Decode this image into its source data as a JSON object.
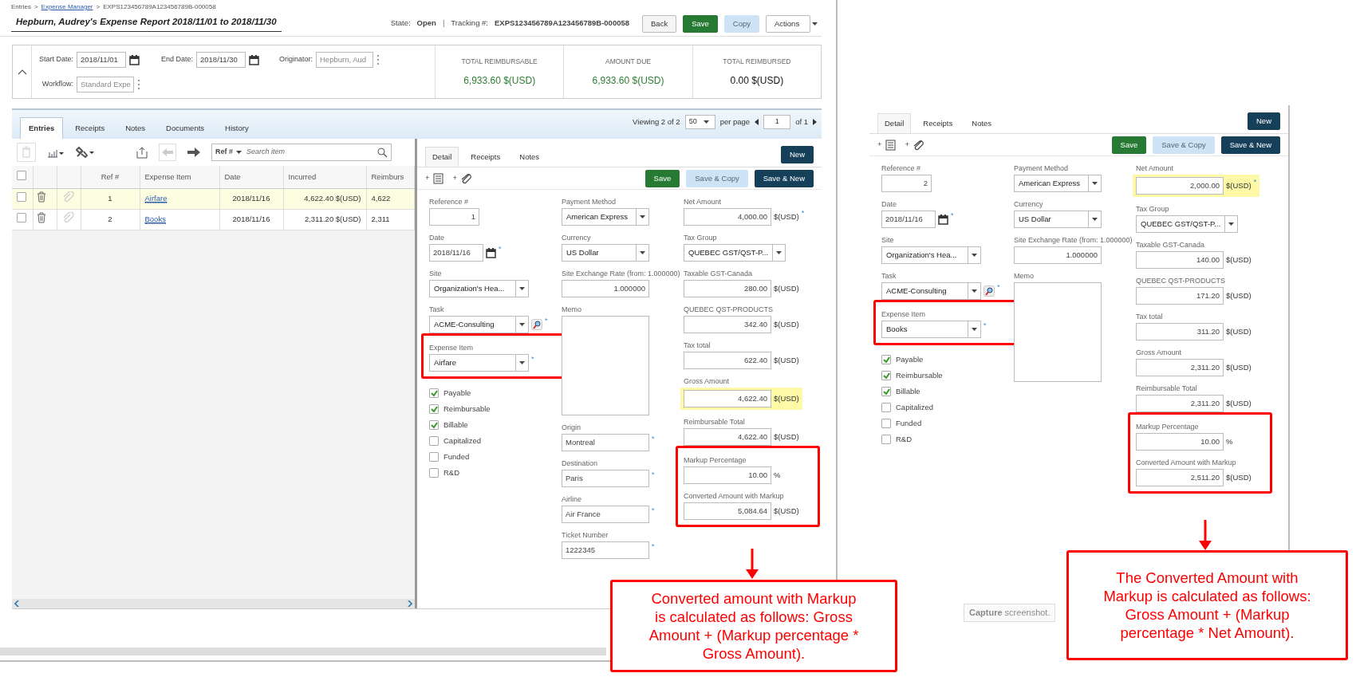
{
  "breadcrumb": {
    "separator": ">",
    "items": [
      {
        "text": "Entries",
        "link": false
      },
      {
        "text": "Expense Manager",
        "link": true
      },
      {
        "text": "EXPS123456789A123456789B-000058",
        "link": false
      }
    ]
  },
  "report": {
    "title": "Hepburn, Audrey's Expense Report 2018/11/01 to 2018/11/30",
    "state_label": "State:",
    "state": "Open",
    "divider": "|",
    "tracking_label": "Tracking #:",
    "tracking": "EXPS123456789A123456789B-000058",
    "buttons": [
      {
        "label": "Back",
        "kind": "default"
      },
      {
        "label": "Save",
        "kind": "success"
      },
      {
        "label": "Copy",
        "kind": "light"
      },
      {
        "label": "Actions",
        "kind": "dropdown"
      }
    ]
  },
  "summary": {
    "expanded": true,
    "fields": [
      {
        "label": "Start Date:",
        "value": "2018/11/01",
        "kind": "date"
      },
      {
        "label": "End Date:",
        "value": "2018/11/30",
        "kind": "date"
      },
      {
        "label": "Originator:",
        "value": "Hepburn, Aud",
        "kind": "picker",
        "disabled": true
      },
      {
        "label": "Workflow:",
        "value": "Standard Expe",
        "kind": "picker",
        "disabled": true
      }
    ],
    "totals": [
      {
        "label": "TOTAL REIMBURSABLE",
        "value": "6,933.60 $(USD)",
        "color": "#2e7d32"
      },
      {
        "label": "AMOUNT DUE",
        "value": "6,933.60 $(USD)",
        "color": "#2e7d32"
      },
      {
        "label": "TOTAL REIMBURSED",
        "value": "0.00 $(USD)",
        "color": "#111111"
      }
    ]
  },
  "tabs": [
    {
      "label": "Entries",
      "selected": true
    },
    {
      "label": "Receipts",
      "selected": false
    },
    {
      "label": "Notes",
      "selected": false
    },
    {
      "label": "Documents",
      "selected": false
    },
    {
      "label": "History",
      "selected": false
    }
  ],
  "pager": {
    "viewing": "Viewing 2 of 2",
    "page_size": "50",
    "per_page": "per page",
    "page": "1",
    "of": "of 1"
  },
  "entries": {
    "all_checked": false,
    "delete_disabled": true,
    "previous_disabled": true,
    "search_by": "Ref #",
    "search_placeholder": "Search item",
    "columns": [
      "Ref #",
      "Expense Item",
      "Date",
      "Incurred",
      "Reimburs"
    ],
    "rows": [
      {
        "ref": "1",
        "item": "Airfare",
        "date": "2018/11/16",
        "incurred": "4,622.40 $(USD)",
        "reimbursable": "4,622",
        "selected": true,
        "checked": false
      },
      {
        "ref": "2",
        "item": "Books",
        "date": "2018/11/16",
        "incurred": "2,311.20 $(USD)",
        "reimbursable": "2,311",
        "selected": false,
        "checked": false
      }
    ]
  },
  "detail_panels": [
    {
      "tabs": [
        {
          "label": "Detail",
          "selected": true
        },
        {
          "label": "Receipts",
          "selected": false
        },
        {
          "label": "Notes",
          "selected": false
        }
      ],
      "new_button": "New",
      "add_marks": [
        "+",
        "+"
      ],
      "actions": [
        {
          "label": "Save",
          "kind": "success"
        },
        {
          "label": "Save & Copy",
          "kind": "light"
        },
        {
          "label": "Save & New",
          "kind": "dark"
        }
      ],
      "col1": [
        {
          "label": "Reference #",
          "kind": "number",
          "value": "1",
          "outlined": false
        },
        {
          "label": "Date",
          "kind": "date",
          "value": "2018/11/16",
          "required": "*",
          "outlined": false
        },
        {
          "label": "Site",
          "kind": "select",
          "value": "Organization's Hea...",
          "outlined": false
        },
        {
          "label": "Task",
          "kind": "lookup",
          "value": "ACME-Consulting",
          "required": "*",
          "outlined": false
        },
        {
          "label": "Expense Item",
          "kind": "select",
          "value": "Airfare",
          "required": "*",
          "outlined": true
        }
      ],
      "checks": [
        {
          "label": "Payable",
          "checked": true
        },
        {
          "label": "Reimbursable",
          "checked": true
        },
        {
          "label": "Billable",
          "checked": true
        },
        {
          "label": "Capitalized",
          "checked": false
        },
        {
          "label": "Funded",
          "checked": false
        },
        {
          "label": "R&D",
          "checked": false
        }
      ],
      "col2": [
        {
          "label": "Payment Method",
          "kind": "select",
          "value": "American Express"
        },
        {
          "label": "Currency",
          "kind": "select",
          "value": "US Dollar"
        },
        {
          "label": "Site Exchange Rate (from: 1.000000)",
          "kind": "number",
          "value": "1.000000"
        },
        {
          "label": "Memo",
          "kind": "memo"
        },
        {
          "label": "Origin",
          "kind": "text",
          "value": "Montreal",
          "required": "*"
        },
        {
          "label": "Destination",
          "kind": "text",
          "value": "Paris",
          "required": "*"
        },
        {
          "label": "Airline",
          "kind": "text",
          "value": "Air France",
          "required": "*"
        },
        {
          "label": "Ticket Number",
          "kind": "text",
          "value": "1222345",
          "required": "*"
        }
      ],
      "col3": [
        {
          "label": "Net Amount",
          "kind": "number",
          "value": "4,000.00",
          "unit": "$(USD)",
          "required": "*",
          "highlighted": false,
          "outlined": false
        },
        {
          "label": "Tax Group",
          "kind": "select",
          "value": "QUEBEC GST/QST-P...",
          "highlighted": false,
          "outlined": false
        },
        {
          "label": "Taxable GST-Canada",
          "kind": "number",
          "value": "280.00",
          "unit": "$(USD)",
          "highlighted": false,
          "outlined": false
        },
        {
          "label": "QUEBEC QST-PRODUCTS",
          "kind": "number",
          "value": "342.40",
          "unit": "$(USD)",
          "highlighted": false,
          "outlined": false
        },
        {
          "label": "Tax total",
          "kind": "number",
          "value": "622.40",
          "unit": "$(USD)",
          "highlighted": false,
          "outlined": false
        },
        {
          "label": "Gross Amount",
          "kind": "number",
          "value": "4,622.40",
          "unit": "$(USD)",
          "highlighted": true,
          "outlined": false
        },
        {
          "label": "Reimbursable Total",
          "kind": "number",
          "value": "4,622.40",
          "unit": "$(USD)",
          "highlighted": false,
          "outlined": false
        },
        {
          "label": "Markup Percentage",
          "kind": "number",
          "value": "10.00",
          "unit": "%",
          "highlighted": false,
          "outlined": true
        },
        {
          "label": "Converted Amount with Markup",
          "kind": "number",
          "value": "5,084.64",
          "unit": "$(USD)",
          "highlighted": false,
          "outlined": true
        }
      ],
      "callout": "Converted amount with Markup is calculated as follows: Gross Amount + (Markup percentage * Gross Amount)."
    },
    {
      "tabs": [
        {
          "label": "Detail",
          "selected": true
        },
        {
          "label": "Receipts",
          "selected": false
        },
        {
          "label": "Notes",
          "selected": false
        }
      ],
      "new_button": "New",
      "add_marks": [
        "+",
        "+"
      ],
      "actions": [
        {
          "label": "Save",
          "kind": "success"
        },
        {
          "label": "Save & Copy",
          "kind": "light"
        },
        {
          "label": "Save & New",
          "kind": "dark"
        }
      ],
      "col1": [
        {
          "label": "Reference #",
          "kind": "number",
          "value": "2",
          "outlined": false
        },
        {
          "label": "Date",
          "kind": "date",
          "value": "2018/11/16",
          "required": "*",
          "outlined": false
        },
        {
          "label": "Site",
          "kind": "select",
          "value": "Organization's Hea...",
          "outlined": false
        },
        {
          "label": "Task",
          "kind": "lookup",
          "value": "ACME-Consulting",
          "required": "*",
          "outlined": false
        },
        {
          "label": "Expense Item",
          "kind": "select",
          "value": "Books",
          "required": "*",
          "outlined": true
        }
      ],
      "checks": [
        {
          "label": "Payable",
          "checked": true
        },
        {
          "label": "Reimbursable",
          "checked": true
        },
        {
          "label": "Billable",
          "checked": true
        },
        {
          "label": "Capitalized",
          "checked": false
        },
        {
          "label": "Funded",
          "checked": false
        },
        {
          "label": "R&D",
          "checked": false
        }
      ],
      "col2": [
        {
          "label": "Payment Method",
          "kind": "select",
          "value": "American Express"
        },
        {
          "label": "Currency",
          "kind": "select",
          "value": "US Dollar"
        },
        {
          "label": "Site Exchange Rate (from: 1.000000)",
          "kind": "number",
          "value": "1.000000"
        },
        {
          "label": "Memo",
          "kind": "memo"
        }
      ],
      "col3": [
        {
          "label": "Net Amount",
          "kind": "number",
          "value": "2,000.00",
          "unit": "$(USD)",
          "required": "*",
          "highlighted": true,
          "outlined": false
        },
        {
          "label": "Tax Group",
          "kind": "select",
          "value": "QUEBEC GST/QST-P...",
          "highlighted": false,
          "outlined": false
        },
        {
          "label": "Taxable GST-Canada",
          "kind": "number",
          "value": "140.00",
          "unit": "$(USD)",
          "highlighted": false,
          "outlined": false
        },
        {
          "label": "QUEBEC QST-PRODUCTS",
          "kind": "number",
          "value": "171.20",
          "unit": "$(USD)",
          "highlighted": false,
          "outlined": false
        },
        {
          "label": "Tax total",
          "kind": "number",
          "value": "311.20",
          "unit": "$(USD)",
          "highlighted": false,
          "outlined": false
        },
        {
          "label": "Gross Amount",
          "kind": "number",
          "value": "2,311.20",
          "unit": "$(USD)",
          "highlighted": false,
          "outlined": false
        },
        {
          "label": "Reimbursable Total",
          "kind": "number",
          "value": "2,311.20",
          "unit": "$(USD)",
          "highlighted": false,
          "outlined": false
        },
        {
          "label": "Markup Percentage",
          "kind": "number",
          "value": "10.00",
          "unit": "%",
          "highlighted": false,
          "outlined": true
        },
        {
          "label": "Converted Amount with Markup",
          "kind": "number",
          "value": "2,511.20",
          "unit": "$(USD)",
          "highlighted": false,
          "outlined": true
        }
      ],
      "callout": "The Converted Amount with Markup is calculated as follows: Gross Amount + (Markup percentage * Net Amount)."
    }
  ],
  "capture_button": {
    "bold": "Capture",
    "rest": "screenshot."
  }
}
